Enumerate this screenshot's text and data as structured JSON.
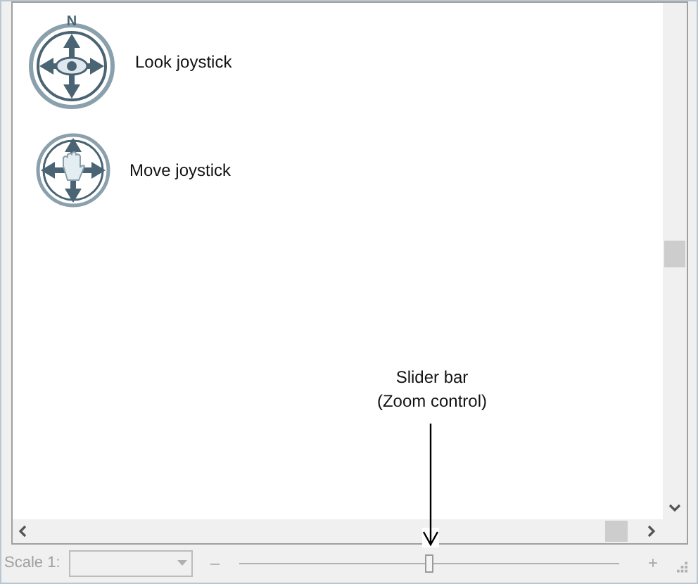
{
  "items": [
    {
      "label": "Look joystick",
      "kind": "look",
      "badge": "N"
    },
    {
      "label": "Move joystick",
      "kind": "move"
    }
  ],
  "annotation": {
    "lines": [
      "Slider bar",
      "(Zoom control)"
    ]
  },
  "status_bar": {
    "scale_label": "Scale 1:",
    "scale_combo": {
      "disabled": true
    },
    "zoom_out": "–",
    "zoom_slider": {
      "level": 0.5
    },
    "zoom_in": "+"
  }
}
